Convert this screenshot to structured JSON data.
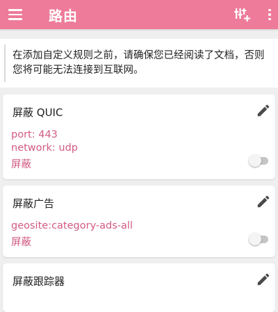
{
  "app_bar": {
    "title": "路由",
    "background_color": "#ee7b99",
    "menu_icon": "hamburger-menu-icon",
    "add_icon": "add-rule-icon",
    "more_icon": "more-vert-icon"
  },
  "notice": {
    "text": "在添加自定义规则之前，请确保您已经阅读了文档，否则您将可能无法连接到互联网。"
  },
  "rules": [
    {
      "name": "屏蔽 QUIC",
      "details": [
        "port: 443",
        "network: udp"
      ],
      "action": "屏蔽",
      "enabled": false
    },
    {
      "name": "屏蔽广告",
      "details": [
        "geosite:category-ads-all"
      ],
      "action": "屏蔽",
      "enabled": false
    },
    {
      "name": "屏蔽跟踪器",
      "details": [],
      "action": "",
      "enabled": false
    }
  ],
  "colors": {
    "accent": "#ee7b99",
    "detail_text": "#d15a82"
  }
}
